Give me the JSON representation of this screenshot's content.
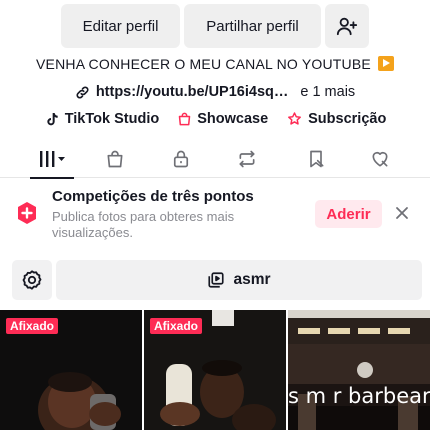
{
  "header": {
    "edit_profile": "Editar perfil",
    "share_profile": "Partilhar perfil",
    "add_friend_icon": "person-plus-icon"
  },
  "bio": {
    "text": "VENHA CONHECER O MEU CANAL NO YOUTUBE",
    "emoji_icon": "play-button-icon",
    "link": "https://youtu.be/UP16i4sq…",
    "link_more": "e 1 mais"
  },
  "badges": {
    "studio": "TikTok Studio",
    "showcase": "Showcase",
    "subscription": "Subscrição"
  },
  "tabs": [
    {
      "name": "videos",
      "icon": "grid-icon",
      "active": true
    },
    {
      "name": "shop",
      "icon": "bag-icon"
    },
    {
      "name": "private",
      "icon": "lock-icon"
    },
    {
      "name": "reposts",
      "icon": "repost-icon"
    },
    {
      "name": "favorites",
      "icon": "bookmark-icon"
    },
    {
      "name": "liked",
      "icon": "heart-icon"
    }
  ],
  "promo": {
    "title": "Competições de três pontos",
    "subtitle": "Publica fotos para obteres mais visualizações.",
    "action": "Aderir"
  },
  "filter": {
    "label": "asmr"
  },
  "videos": [
    {
      "pinned_label": "Afixado"
    },
    {
      "pinned_label": "Afixado"
    },
    {
      "overlay": "s m r barbearia"
    }
  ],
  "colors": {
    "accent": "#fe2c55",
    "text": "#161823",
    "muted": "#8a8b91",
    "button_bg": "#efefef"
  }
}
